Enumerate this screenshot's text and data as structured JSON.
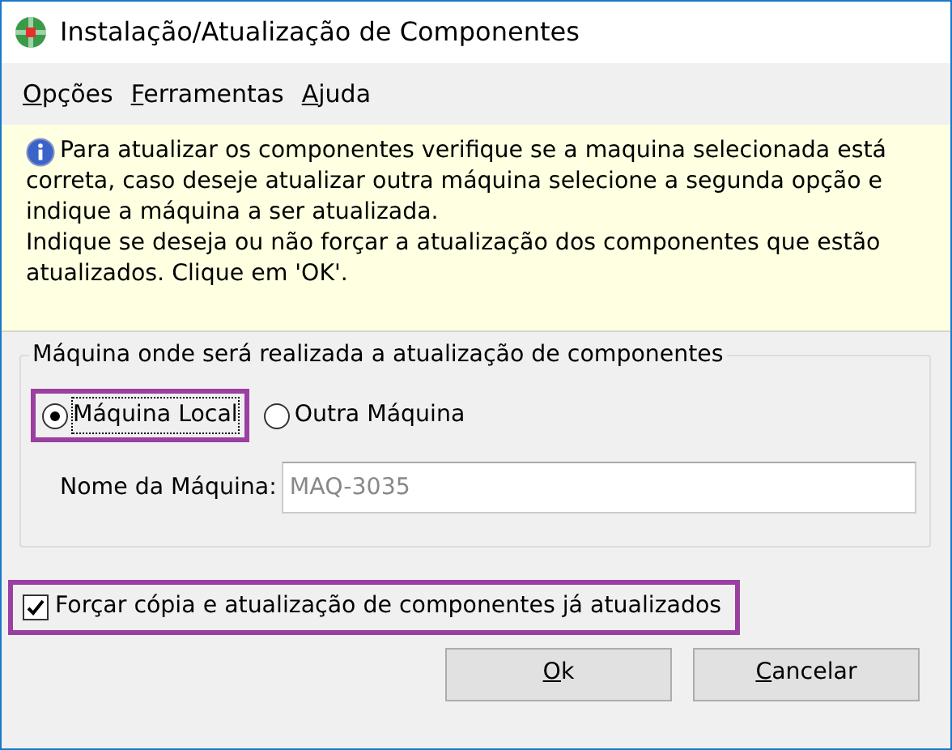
{
  "window": {
    "title": "Instalação/Atualização de Componentes"
  },
  "menu": [
    {
      "label": "Opções"
    },
    {
      "label": "Ferramentas"
    },
    {
      "label": "Ajuda"
    }
  ],
  "info": {
    "lines": [
      "Para atualizar os componentes verifique se a maquina selecionada está",
      "correta, caso deseje atualizar outra máquina selecione a segunda opção e",
      "indique a máquina a ser atualizada.",
      "Indique se deseja ou não forçar a atualização dos componentes que estão",
      "atualizados. Clique em 'OK'."
    ]
  },
  "group": {
    "title": "Máquina onde será realizada a atualização de componentes",
    "radios": [
      {
        "label": "Máquina Local",
        "selected": true,
        "highlighted": true
      },
      {
        "label": "Outra Máquina",
        "selected": false,
        "highlighted": false
      }
    ],
    "machine_name": {
      "label": "Nome da Máquina:",
      "value": "MAQ-3035",
      "disabled": true
    }
  },
  "force_checkbox": {
    "label": "Forçar cópia e atualização de componentes já atualizados",
    "checked": true,
    "highlighted": true
  },
  "buttons": [
    {
      "label": "Ok"
    },
    {
      "label": "Cancelar"
    }
  ]
}
